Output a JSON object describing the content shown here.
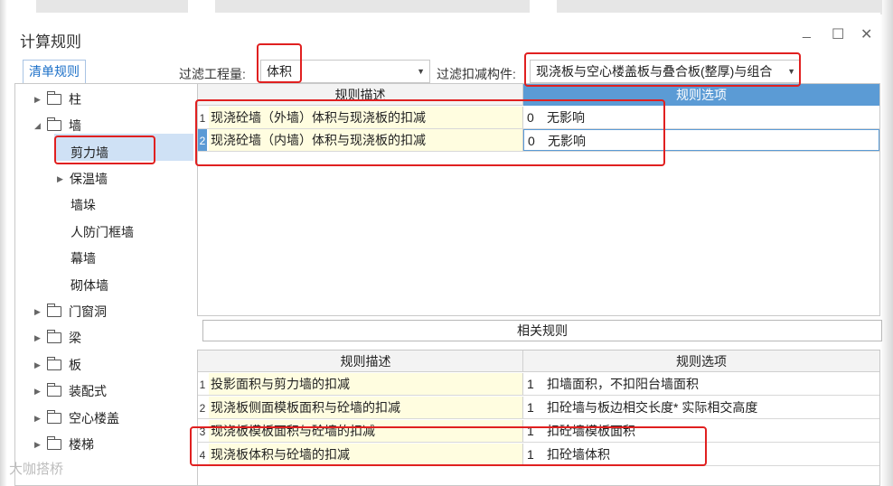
{
  "window": {
    "title": "计算规则",
    "controls": {
      "minimize": "_",
      "maximize": "☐",
      "close": "✕"
    }
  },
  "tabs": {
    "bill_rules": "清单规则"
  },
  "filters": {
    "quantity_label": "过滤工程量:",
    "quantity_value": "体积",
    "component_label": "过滤扣减构件:",
    "component_value": "现浇板与空心楼盖板与叠合板(整厚)与组合"
  },
  "tree": [
    {
      "label": "柱",
      "type": "folder",
      "expanded": false
    },
    {
      "label": "墙",
      "type": "folder",
      "expanded": true
    },
    {
      "label": "剪力墙",
      "type": "leaf",
      "selected": true
    },
    {
      "label": "保温墙",
      "type": "leaf",
      "expandable": true
    },
    {
      "label": "墙垛",
      "type": "leaf"
    },
    {
      "label": "人防门框墙",
      "type": "leaf"
    },
    {
      "label": "幕墙",
      "type": "leaf"
    },
    {
      "label": "砌体墙",
      "type": "leaf"
    },
    {
      "label": "门窗洞",
      "type": "folder",
      "expanded": false
    },
    {
      "label": "梁",
      "type": "folder",
      "expanded": false
    },
    {
      "label": "板",
      "type": "folder",
      "expanded": false
    },
    {
      "label": "装配式",
      "type": "folder",
      "expanded": false
    },
    {
      "label": "空心楼盖",
      "type": "folder",
      "expanded": false
    },
    {
      "label": "楼梯",
      "type": "folder",
      "expanded": false
    }
  ],
  "rules_grid": {
    "col_desc": "规则描述",
    "col_option": "规则选项",
    "rows": [
      {
        "no": "1",
        "desc": "现浇砼墙（外墙）体积与现浇板的扣减",
        "opt_no": "0",
        "opt": "无影响"
      },
      {
        "no": "2",
        "desc": "现浇砼墙（内墙）体积与现浇板的扣减",
        "opt_no": "0",
        "opt": "无影响"
      }
    ]
  },
  "related_rules_label": "相关规则",
  "related_grid": {
    "col_desc": "规则描述",
    "col_option": "规则选项",
    "rows": [
      {
        "no": "1",
        "desc": "投影面积与剪力墙的扣减",
        "opt_no": "1",
        "opt": "扣墙面积，不扣阳台墙面积"
      },
      {
        "no": "2",
        "desc": "现浇板侧面模板面积与砼墙的扣减",
        "opt_no": "1",
        "opt": "扣砼墙与板边相交长度* 实际相交高度"
      },
      {
        "no": "3",
        "desc": "现浇板模板面积与砼墙的扣减",
        "opt_no": "1",
        "opt": "扣砼墙模板面积"
      },
      {
        "no": "4",
        "desc": "现浇板体积与砼墙的扣减",
        "opt_no": "1",
        "opt": "扣砼墙体积"
      }
    ]
  },
  "watermark": "大咖搭桥",
  "colors": {
    "accent": "#5b9bd5",
    "highlight": "#e02020",
    "row_fill": "#fffde0",
    "selection": "#cfe1f5"
  }
}
